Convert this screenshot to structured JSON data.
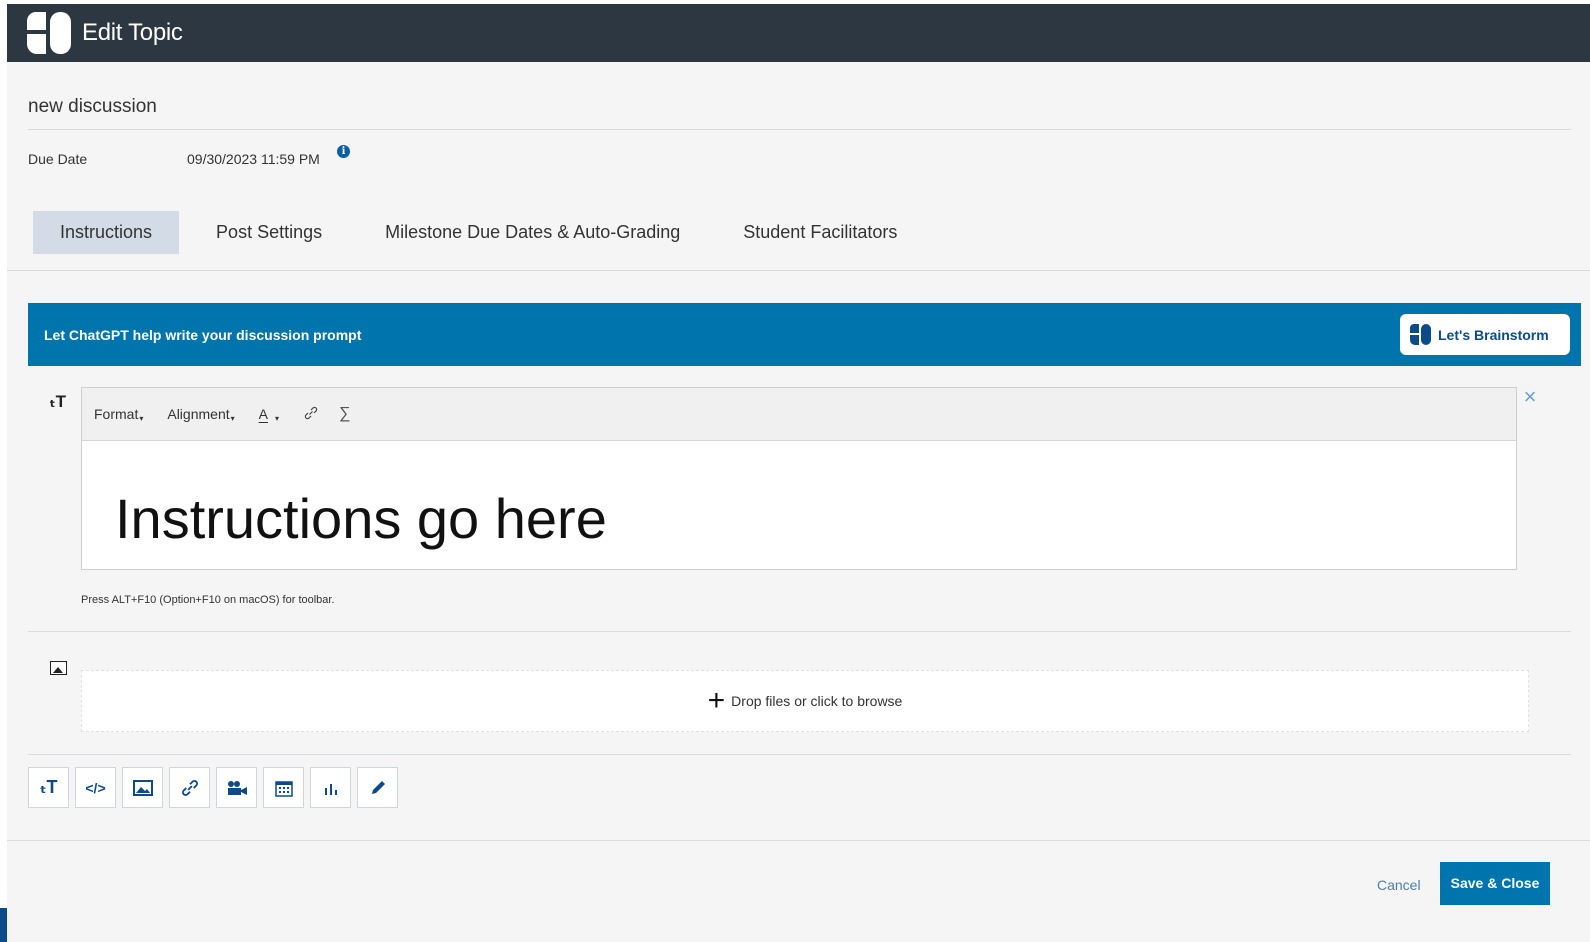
{
  "header": {
    "title": "Edit Topic"
  },
  "topic": {
    "name": "new discussion"
  },
  "due": {
    "label": "Due Date",
    "value": "09/30/2023 11:59 PM",
    "info_glyph": "i"
  },
  "tabs": [
    {
      "label": "Instructions",
      "active": true
    },
    {
      "label": "Post Settings",
      "active": false
    },
    {
      "label": "Milestone Due Dates & Auto-Grading",
      "active": false
    },
    {
      "label": "Student Facilitators",
      "active": false
    }
  ],
  "chatgpt": {
    "prompt": "Let ChatGPT help write your discussion prompt",
    "button": "Let's Brainstorm"
  },
  "editor": {
    "side_glyph": "ₜT",
    "toolbar": {
      "format": "Format",
      "alignment": "Alignment",
      "font_color": "A",
      "caret": "▾",
      "link_glyph": "🔗",
      "formula_glyph": "∑"
    },
    "content": "Instructions go here",
    "close_glyph": "×",
    "hint": "Press ALT+F10 (Option+F10 on macOS) for toolbar."
  },
  "upload": {
    "plus": "+",
    "text": "Drop files or click to browse"
  },
  "block_buttons": [
    {
      "name": "text-block-button",
      "glyph": "ₜT"
    },
    {
      "name": "code-block-button",
      "glyph": "</>"
    },
    {
      "name": "image-block-button",
      "glyph": "▣"
    },
    {
      "name": "link-block-button",
      "glyph": "🔗"
    },
    {
      "name": "video-block-button",
      "glyph": "🎥"
    },
    {
      "name": "calendar-block-button",
      "glyph": "▦"
    },
    {
      "name": "chart-block-button",
      "glyph": "ıl"
    },
    {
      "name": "draw-block-button",
      "glyph": "✎"
    }
  ],
  "footer": {
    "cancel": "Cancel",
    "save": "Save & Close"
  },
  "colors": {
    "header_bg": "#2d3741",
    "accent": "#0075ad",
    "brand": "#0d4a8a",
    "tab_active": "#d3dbe7"
  }
}
